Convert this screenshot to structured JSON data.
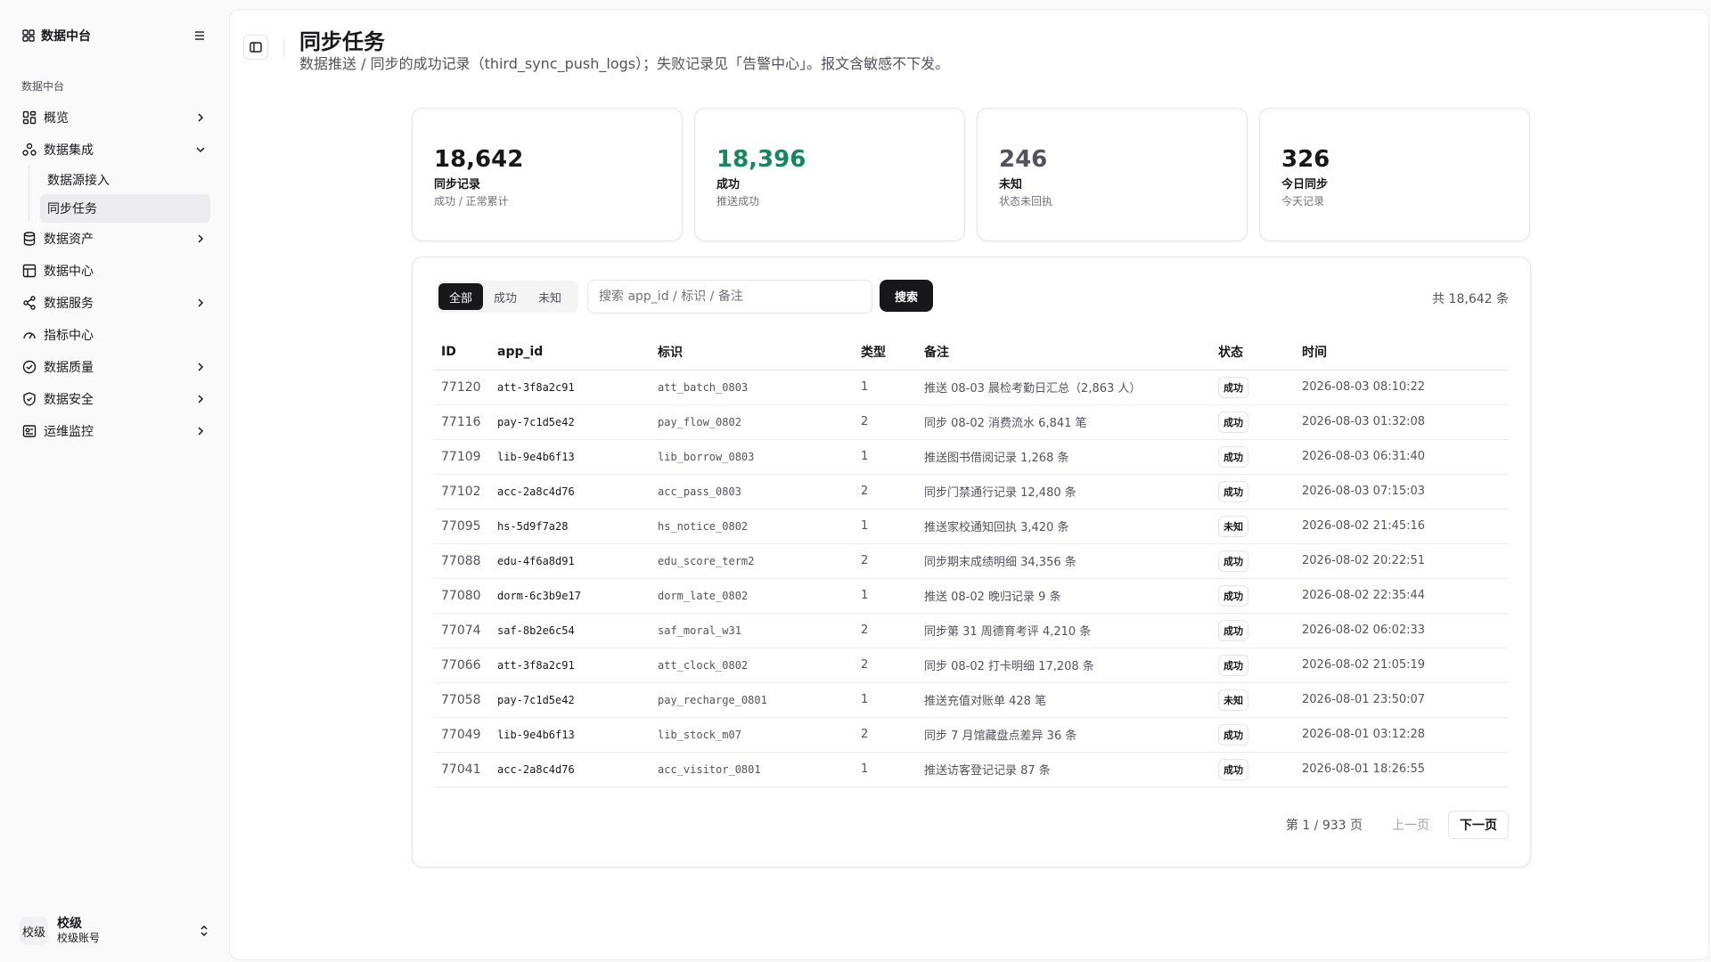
{
  "sidebar": {
    "brand": "数据中台",
    "group_label": "数据中台",
    "items": [
      {
        "label": "概览",
        "icon": "dashboard-icon"
      },
      {
        "label": "数据集成",
        "icon": "integration-icon"
      },
      {
        "label": "数据资产",
        "icon": "database-icon"
      },
      {
        "label": "数据中心",
        "icon": "table-icon"
      },
      {
        "label": "数据服务",
        "icon": "share-icon"
      },
      {
        "label": "指标中心",
        "icon": "gauge-icon"
      },
      {
        "label": "数据质量",
        "icon": "check-circle-icon"
      },
      {
        "label": "数据安全",
        "icon": "shield-icon"
      },
      {
        "label": "运维监控",
        "icon": "monitor-icon"
      }
    ],
    "sub_items": [
      {
        "label": "数据源接入"
      },
      {
        "label": "同步任务"
      }
    ],
    "user": {
      "avatar": "校级",
      "name": "校级",
      "account": "校级账号"
    }
  },
  "header": {
    "title": "同步任务",
    "subtitle": "数据推送 / 同步的成功记录（third_sync_push_logs）；失败记录见「告警中心」。报文含敏感不下发。"
  },
  "stats": [
    {
      "value": "18,642",
      "label": "同步记录",
      "sub": "成功 / 正常累计",
      "color": "#18181b"
    },
    {
      "value": "18,396",
      "label": "成功",
      "sub": "推送成功",
      "color": "#16875c"
    },
    {
      "value": "246",
      "label": "未知",
      "sub": "状态未回执",
      "color": "#52525b"
    },
    {
      "value": "326",
      "label": "今日同步",
      "sub": "今天记录",
      "color": "#18181b"
    }
  ],
  "filters": {
    "tabs": [
      "全部",
      "成功",
      "未知"
    ],
    "search_placeholder": "搜索 app_id / 标识 / 备注",
    "search_button": "搜索",
    "total": "共 18,642 条"
  },
  "table": {
    "headers": [
      "ID",
      "app_id",
      "标识",
      "类型",
      "备注",
      "状态",
      "时间"
    ],
    "rows": [
      [
        "77120",
        "att-3f8a2c91",
        "att_batch_0803",
        "1",
        "推送 08-03 晨检考勤日汇总（2,863 人）",
        "成功",
        "2026-08-03 08:10:22"
      ],
      [
        "77116",
        "pay-7c1d5e42",
        "pay_flow_0802",
        "2",
        "同步 08-02 消费流水 6,841 笔",
        "成功",
        "2026-08-03 01:32:08"
      ],
      [
        "77109",
        "lib-9e4b6f13",
        "lib_borrow_0803",
        "1",
        "推送图书借阅记录 1,268 条",
        "成功",
        "2026-08-03 06:31:40"
      ],
      [
        "77102",
        "acc-2a8c4d76",
        "acc_pass_0803",
        "2",
        "同步门禁通行记录 12,480 条",
        "成功",
        "2026-08-03 07:15:03"
      ],
      [
        "77095",
        "hs-5d9f7a28",
        "hs_notice_0802",
        "1",
        "推送家校通知回执 3,420 条",
        "未知",
        "2026-08-02 21:45:16"
      ],
      [
        "77088",
        "edu-4f6a8d91",
        "edu_score_term2",
        "2",
        "同步期末成绩明细 34,356 条",
        "成功",
        "2026-08-02 20:22:51"
      ],
      [
        "77080",
        "dorm-6c3b9e17",
        "dorm_late_0802",
        "1",
        "推送 08-02 晚归记录 9 条",
        "成功",
        "2026-08-02 22:35:44"
      ],
      [
        "77074",
        "saf-8b2e6c54",
        "saf_moral_w31",
        "2",
        "同步第 31 周德育考评 4,210 条",
        "成功",
        "2026-08-02 06:02:33"
      ],
      [
        "77066",
        "att-3f8a2c91",
        "att_clock_0802",
        "2",
        "同步 08-02 打卡明细 17,208 条",
        "成功",
        "2026-08-02 21:05:19"
      ],
      [
        "77058",
        "pay-7c1d5e42",
        "pay_recharge_0801",
        "1",
        "推送充值对账单 428 笔",
        "未知",
        "2026-08-01 23:50:07"
      ],
      [
        "77049",
        "lib-9e4b6f13",
        "lib_stock_m07",
        "2",
        "同步 7 月馆藏盘点差异 36 条",
        "成功",
        "2026-08-01 03:12:28"
      ],
      [
        "77041",
        "acc-2a8c4d76",
        "acc_visitor_0801",
        "1",
        "推送访客登记记录 87 条",
        "成功",
        "2026-08-01 18:26:55"
      ]
    ]
  },
  "pagination": {
    "info": "第 1 / 933 页",
    "prev": "上一页",
    "next": "下一页"
  }
}
